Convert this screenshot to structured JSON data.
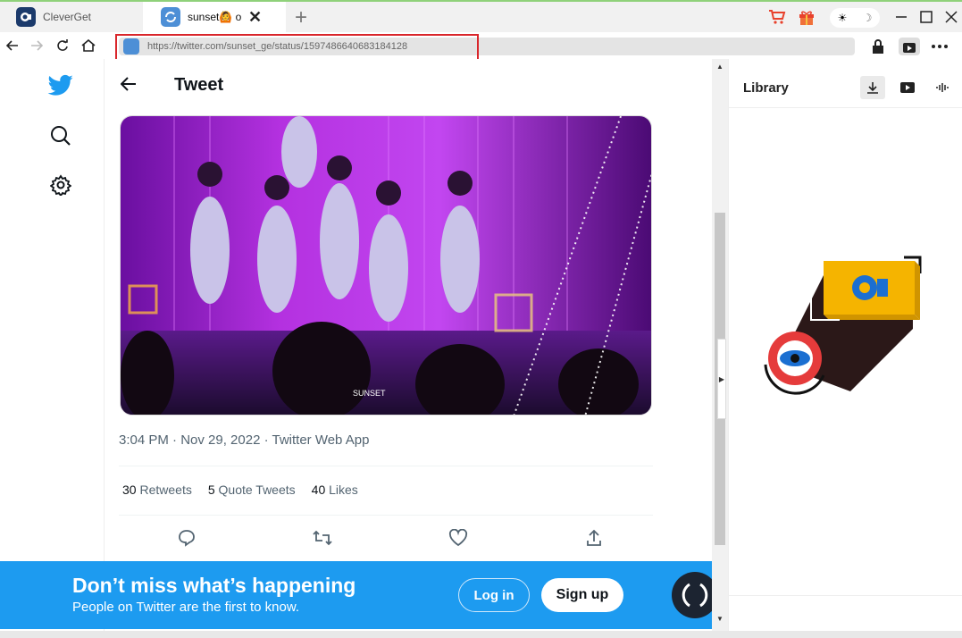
{
  "browser": {
    "tabs": [
      {
        "label": "CleverGet",
        "active": false
      },
      {
        "label": "sunset🙆 on",
        "active": true
      }
    ],
    "new_tab_icon": "plus-icon",
    "address": {
      "url": "https://twitter.com/sunset_ge/status/1597486640683184128"
    },
    "theme_toggle": {
      "light": "☀",
      "dark": "☽"
    }
  },
  "twitter": {
    "sidebar_icons": [
      "twitter-bird-icon",
      "search-icon",
      "gear-icon"
    ],
    "header": {
      "title": "Tweet"
    },
    "tweet": {
      "meta": "3:04 PM · Nov 29, 2022 · Twitter Web App",
      "stats": [
        {
          "count": "30",
          "label": "Retweets"
        },
        {
          "count": "5",
          "label": "Quote Tweets"
        },
        {
          "count": "40",
          "label": "Likes"
        }
      ],
      "media_watermark": "SUNSET"
    },
    "banner": {
      "headline": "Don’t miss what’s happening",
      "subtext": "People on Twitter are the first to know.",
      "login_label": "Log in",
      "signup_label": "Sign up"
    }
  },
  "library": {
    "title": "Library",
    "tabs": [
      "download-icon",
      "video-icon",
      "audio-icon"
    ]
  },
  "colors": {
    "accent": "#1d9bf0",
    "highlight": "#d9262b",
    "cleverget_blue": "#1b6fd1",
    "cleverget_yellow": "#f5b400"
  }
}
